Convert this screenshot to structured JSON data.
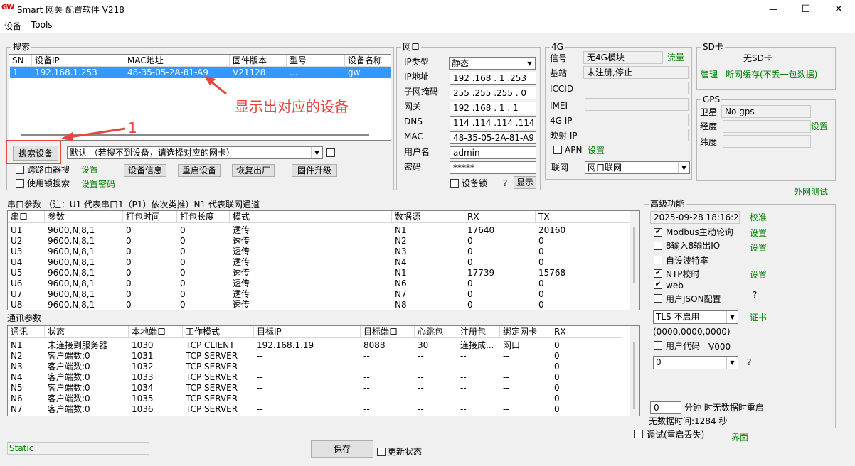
{
  "window": {
    "logo": "GW",
    "title": "Smart 网关 配置软件    V218",
    "minimize": "—",
    "maximize": "☐",
    "close": "✕"
  },
  "menu": {
    "device": "设备",
    "tools": "Tools"
  },
  "search": {
    "group_label": "搜索",
    "columns": [
      "SN",
      "设备IP",
      "MAC地址",
      "固件版本",
      "型号",
      "设备名称"
    ],
    "rows": [
      [
        "1",
        "192.168.1.253",
        "48-35-05-2A-81-A9",
        "V21128",
        "...",
        "gw"
      ]
    ],
    "annotation_text": "显示出对应的设备",
    "annotation_number": "1",
    "search_btn": "搜索设备",
    "nic_select": "默认 （若搜不到设备，请选择对应的网卡）",
    "cross_router": "跨路由器搜",
    "settings_link": "设置",
    "use_lock": "使用锁搜索",
    "set_password": "设置密码",
    "device_info_btn": "设备信息",
    "reboot_btn": "重启设备",
    "factory_btn": "恢复出厂",
    "firmware_btn": "固件升级"
  },
  "netport": {
    "group_label": "网口",
    "ip_type_label": "IP类型",
    "ip_type": "静态",
    "ip_label": "IP地址",
    "ip": "192 .168 .  1  .253",
    "mask_label": "子网掩码",
    "mask": "255 .255 .255 .  0",
    "gw_label": "网关",
    "gw": "192 .168 .  1  .  1",
    "dns_label": "DNS",
    "dns": "114 .114 .114 .114",
    "mac_label": "MAC",
    "mac": "48-35-05-2A-81-A9",
    "user_label": "用户名",
    "user": "admin",
    "pwd_label": "密码",
    "pwd": "*****",
    "devlock": "设备锁",
    "question": "?",
    "show_btn": "显示"
  },
  "g4": {
    "group_label": "4G",
    "signal_label": "信号",
    "signal": "无4G模块",
    "traffic": "流量",
    "base_label": "基站",
    "base": "未注册,停止",
    "iccid_label": "ICCID",
    "imei_label": "IMEI",
    "ip_label": "4G IP",
    "map_label": "映射 IP",
    "apn": "APN",
    "apn_set": "设置",
    "net_label": "联网",
    "net": "网口联网"
  },
  "sd": {
    "group_label": "SD卡",
    "status": "无SD卡",
    "manage": "管理",
    "cache": "断网缓存(不丢一包数据)"
  },
  "gps": {
    "group_label": "GPS",
    "sat_label": "卫星",
    "sat": "No gps",
    "lon_label": "经度",
    "lat_label": "纬度",
    "set": "设置"
  },
  "external_test": "外网测试",
  "serial": {
    "label": "串口参数  （注：U1 代表串口1（P1）依次类推）N1 代表联网通道",
    "columns": [
      "串口",
      "参数",
      "打包时间",
      "打包长度",
      "模式",
      "数据源",
      "RX",
      "TX"
    ],
    "rows": [
      [
        "U1",
        "9600,N,8,1",
        "0",
        "0",
        "透传",
        "N1",
        "17640",
        "20160"
      ],
      [
        "U2",
        "9600,N,8,1",
        "0",
        "0",
        "透传",
        "N2",
        "0",
        "0"
      ],
      [
        "U3",
        "9600,N,8,1",
        "0",
        "0",
        "透传",
        "N3",
        "0",
        "0"
      ],
      [
        "U4",
        "9600,N,8,1",
        "0",
        "0",
        "透传",
        "N4",
        "0",
        "0"
      ],
      [
        "U5",
        "9600,N,8,1",
        "0",
        "0",
        "透传",
        "N1",
        "17739",
        "15768"
      ],
      [
        "U6",
        "9600,N,8,1",
        "0",
        "0",
        "透传",
        "N6",
        "0",
        "0"
      ],
      [
        "U7",
        "9600,N,8,1",
        "0",
        "0",
        "透传",
        "N7",
        "0",
        "0"
      ],
      [
        "U8",
        "9600,N,8,1",
        "0",
        "0",
        "透传",
        "N8",
        "0",
        "0"
      ]
    ]
  },
  "comm": {
    "label": "通讯参数",
    "columns": [
      "通讯",
      "状态",
      "本地端口",
      "工作模式",
      "目标IP",
      "目标端口",
      "心跳包",
      "注册包",
      "绑定网卡",
      "RX"
    ],
    "rows": [
      [
        "N1",
        "未连接到服务器",
        "1030",
        "TCP CLIENT",
        "192.168.1.19",
        "8088",
        "30",
        "连接成...",
        "网口",
        "0"
      ],
      [
        "N2",
        "客户端数:0",
        "1031",
        "TCP SERVER",
        "--",
        "--",
        "--",
        "--",
        "--",
        "0"
      ],
      [
        "N3",
        "客户端数:0",
        "1032",
        "TCP SERVER",
        "--",
        "--",
        "--",
        "--",
        "--",
        "0"
      ],
      [
        "N4",
        "客户端数:0",
        "1033",
        "TCP SERVER",
        "--",
        "--",
        "--",
        "--",
        "--",
        "0"
      ],
      [
        "N5",
        "客户端数:0",
        "1034",
        "TCP SERVER",
        "--",
        "--",
        "--",
        "--",
        "--",
        "0"
      ],
      [
        "N6",
        "客户端数:0",
        "1035",
        "TCP SERVER",
        "--",
        "--",
        "--",
        "--",
        "--",
        "0"
      ],
      [
        "N7",
        "客户端数:0",
        "1036",
        "TCP SERVER",
        "--",
        "--",
        "--",
        "--",
        "--",
        "0"
      ]
    ]
  },
  "advanced": {
    "group_label": "高级功能",
    "datetime": "2025-09-28 18:16:24",
    "calibrate": "校准",
    "modbus": "Modbus主动轮询",
    "modbus_set": "设置",
    "io": "8输入8输出IO",
    "io_set": "设置",
    "baud": "自设波特率",
    "ntp": "NTP校时",
    "ntp_set": "设置",
    "web": "web",
    "json": "用户JSON配置",
    "json_q": "?",
    "tls": "TLS 不启用",
    "cert": "证书",
    "tls_params": "(0000,0000,0000)",
    "user_code": "用户代码",
    "user_code_ver": "V000",
    "code_sel": "0",
    "code_q": "?",
    "minutes": "0",
    "restart_label": "分钟 时无数据时重启",
    "nodata": "无数据时间:1284 秒"
  },
  "bottom": {
    "debug": "调试(重启丢失)",
    "ui": "界面",
    "save_btn": "保存",
    "update_state": "更新状态",
    "status": "Static"
  },
  "colors": {
    "accent": "#3399ff",
    "annotation_red": "#e8453c",
    "link_green": "#008000"
  }
}
